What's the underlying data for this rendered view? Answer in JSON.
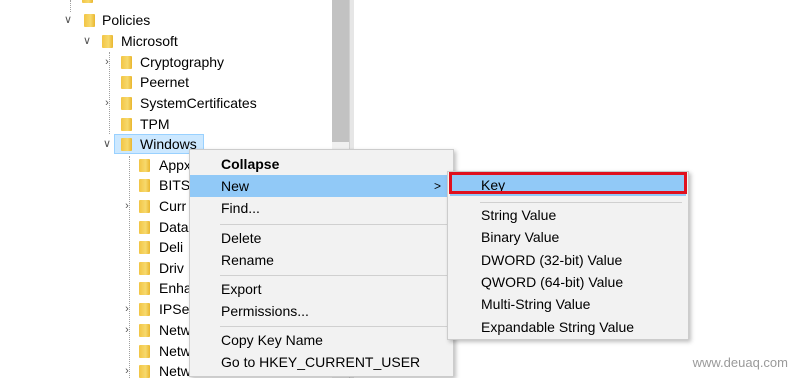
{
  "tree": {
    "policies": "Policies",
    "microsoft": "Microsoft",
    "cryptography": "Cryptography",
    "peernet": "Peernet",
    "systemcertificates": "SystemCertificates",
    "tpm": "TPM",
    "windows": "Windows",
    "children": [
      "Appx",
      "BITS",
      "Curr",
      "Data",
      "Deli",
      "Driv",
      "Enha",
      "IPSe",
      "Netw",
      "Netw",
      "Netw"
    ]
  },
  "context_menu": {
    "collapse": "Collapse",
    "new": "New",
    "new_arrow": ">",
    "find": "Find...",
    "delete": "Delete",
    "rename": "Rename",
    "export": "Export",
    "permissions": "Permissions...",
    "copy_key_name": "Copy Key Name",
    "goto": "Go to HKEY_CURRENT_USER"
  },
  "submenu": {
    "key": "Key",
    "string_value": "String Value",
    "binary_value": "Binary Value",
    "dword": "DWORD (32-bit) Value",
    "qword": "QWORD (64-bit) Value",
    "multi_string": "Multi-String Value",
    "expandable_string": "Expandable String Value"
  },
  "watermark": "www.deuaq.com",
  "colors": {
    "menu_bg": "#f2f2f2",
    "menu_highlight": "#91c9f7",
    "annotation_red": "#e0101e",
    "folder_yellow": "#f2c544"
  }
}
